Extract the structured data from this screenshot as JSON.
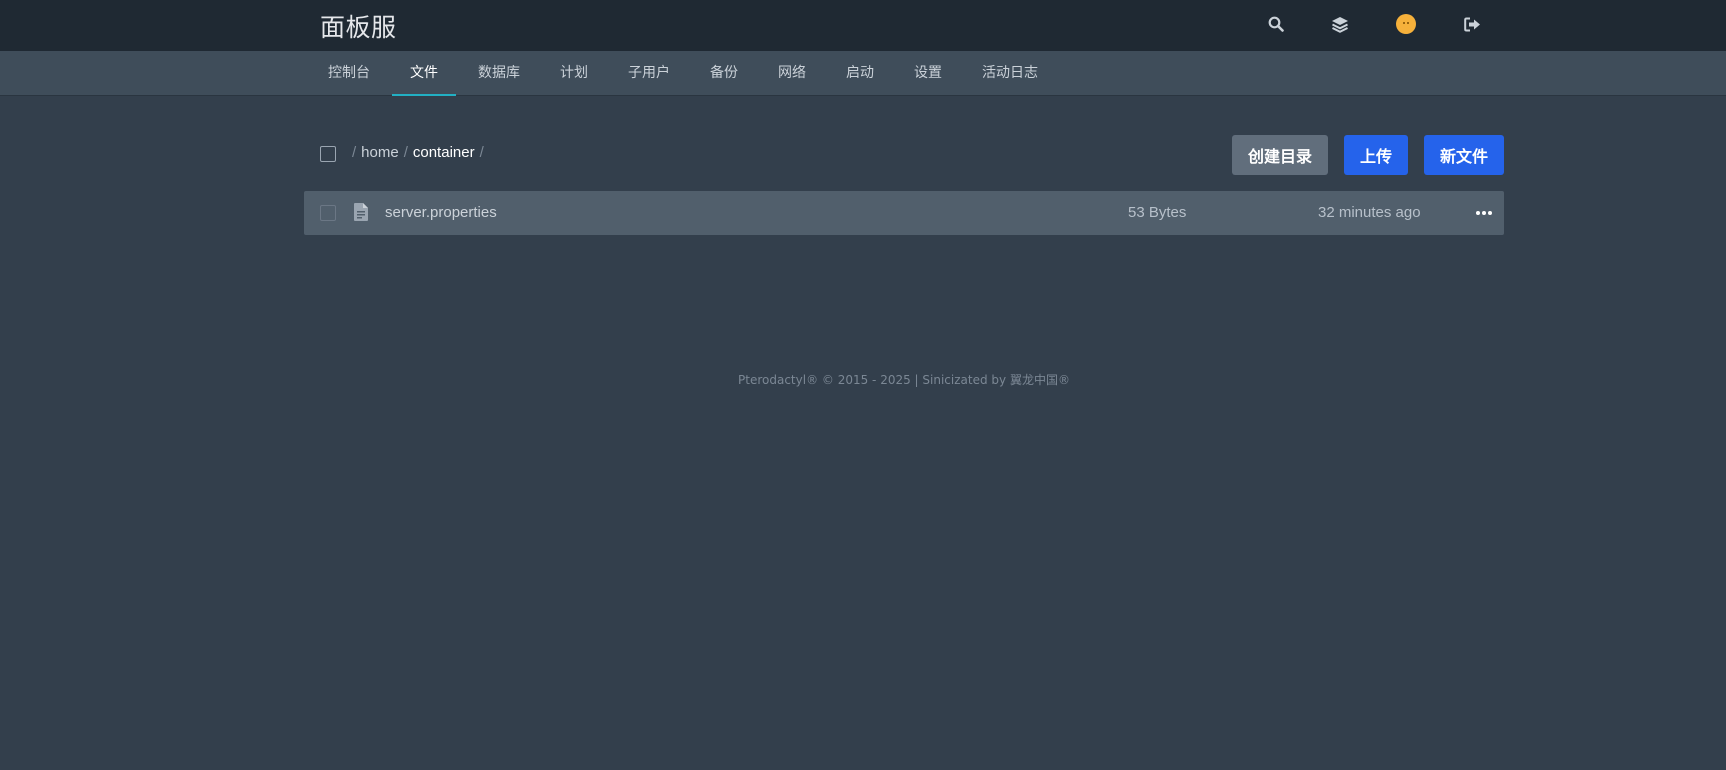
{
  "header": {
    "brand": "面板服",
    "icons": [
      "search-icon",
      "layers-icon",
      "avatar",
      "logout-icon"
    ]
  },
  "nav": {
    "tabs": [
      {
        "label": "控制台"
      },
      {
        "label": "文件"
      },
      {
        "label": "数据库"
      },
      {
        "label": "计划"
      },
      {
        "label": "子用户"
      },
      {
        "label": "备份"
      },
      {
        "label": "网络"
      },
      {
        "label": "启动"
      },
      {
        "label": "设置"
      },
      {
        "label": "活动日志"
      }
    ],
    "active_tab": "文件"
  },
  "files": {
    "breadcrumb": {
      "root_sep": "/",
      "segments": [
        "home",
        "container"
      ],
      "sep": "/"
    },
    "actions": {
      "create_dir": "创建目录",
      "upload": "上传",
      "new_file": "新文件"
    },
    "rows": [
      {
        "name": "server.properties",
        "size": "53 Bytes",
        "modified": "32 minutes ago"
      }
    ]
  },
  "footer": {
    "text": "Pterodactyl® © 2015 - 2025 | Sinicizated by 翼龙中国®"
  },
  "colors": {
    "background": "#333f4c",
    "header": "#1f2933",
    "navbar": "#3f4d5a",
    "active_tab_underline": "#22b0c4",
    "primary_button": "#2563eb",
    "secondary_button": "#616e7c",
    "file_row": "#515f6c",
    "avatar": "#f6b13b"
  }
}
